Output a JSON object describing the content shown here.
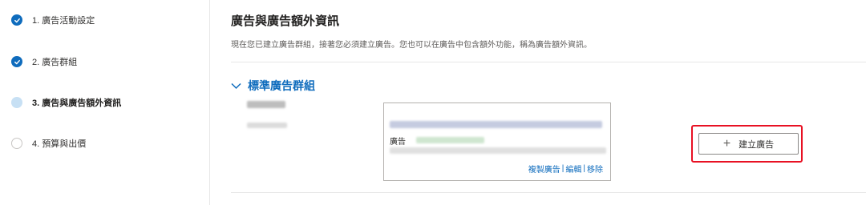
{
  "wizard": {
    "steps": [
      {
        "label": "1. 廣告活動設定",
        "state": "done"
      },
      {
        "label": "2. 廣告群組",
        "state": "done"
      },
      {
        "label": "3. 廣告與廣告額外資訊",
        "state": "current"
      },
      {
        "label": "4. 預算與出價",
        "state": "todo"
      }
    ]
  },
  "main": {
    "title": "廣告與廣告額外資訊",
    "description": "現在您已建立廣告群組，接著您必須建立廣告。您也可以在廣告中包含額外功能，稱為廣告額外資訊。",
    "ad_group": {
      "name": "標準廣告群組",
      "ad_card": {
        "ad_label": "廣告",
        "actions": {
          "copy": "複製廣告",
          "edit": "編輯",
          "remove": "移除",
          "separator": "|"
        }
      },
      "create_ad_label": "建立廣告"
    }
  },
  "colors": {
    "accent": "#0f6cbd",
    "highlight": "#e81123"
  }
}
